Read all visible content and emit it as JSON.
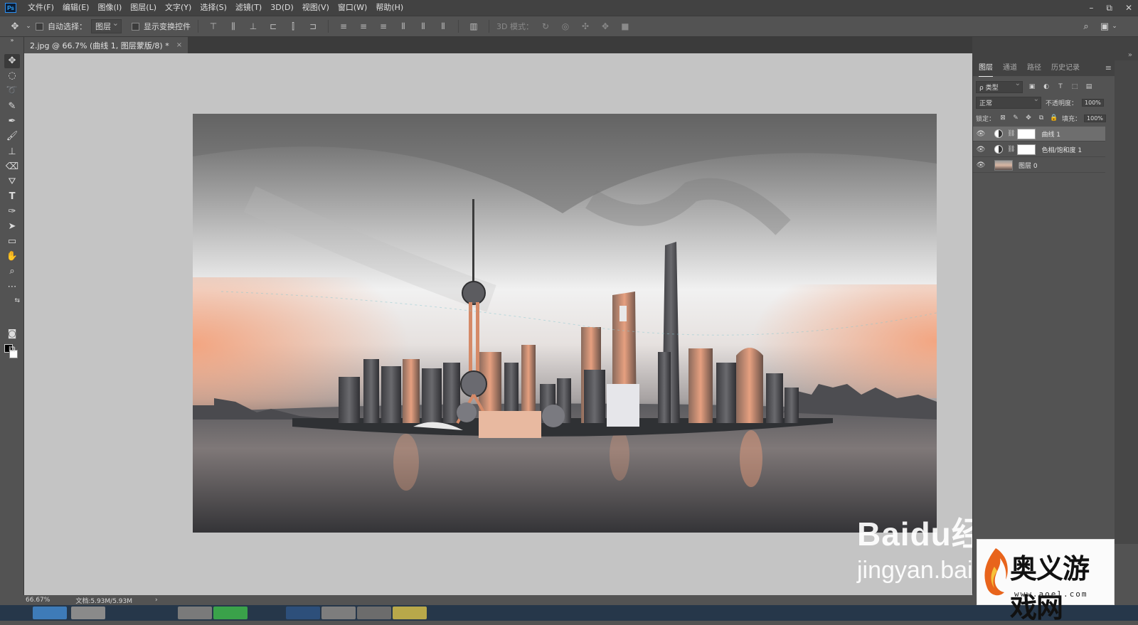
{
  "app": {
    "logo_text": "Ps"
  },
  "menu": [
    "文件(F)",
    "编辑(E)",
    "图像(I)",
    "图层(L)",
    "文字(Y)",
    "选择(S)",
    "滤镜(T)",
    "3D(D)",
    "视图(V)",
    "窗口(W)",
    "帮助(H)"
  ],
  "window_controls": {
    "minimize": "–",
    "restore": "⧉",
    "close": "✕"
  },
  "options": {
    "auto_select_label": "自动选择：",
    "auto_select_value": "图层",
    "show_transform_label": "显示变换控件",
    "mode_3d_label": "3D 模式："
  },
  "document_tab": {
    "title": "2.jpg @ 66.7% (曲线 1, 图层蒙版/8) *",
    "close": "×"
  },
  "status": {
    "zoom": "66.67%",
    "doc_info": "文档:5.93M/5.93M",
    "arrow": "›"
  },
  "panel": {
    "tabs": [
      "图层",
      "通道",
      "路径",
      "历史记录"
    ],
    "filter_kind": "ρ 类型",
    "blend_mode": "正常",
    "opacity_label": "不透明度：",
    "opacity_value": "100%",
    "lock_label": "锁定：",
    "fill_label": "填充：",
    "fill_value": "100%",
    "layers": [
      {
        "name": "曲线 1",
        "kind": "adjustment",
        "selected": true
      },
      {
        "name": "色相/饱和度 1",
        "kind": "adjustment",
        "selected": false
      },
      {
        "name": "图层 0",
        "kind": "pixel",
        "selected": false
      }
    ]
  },
  "watermarks": {
    "baidu": "Baidu经验",
    "jingyan": "jingyan.bai",
    "aoel_name": "奥义游戏网",
    "aoel_url": "www.aoel.com"
  },
  "colors": {
    "accent": "#31a8ff",
    "sky_orange": "#f3a27c",
    "selected_layer": "#6e6e6e"
  }
}
